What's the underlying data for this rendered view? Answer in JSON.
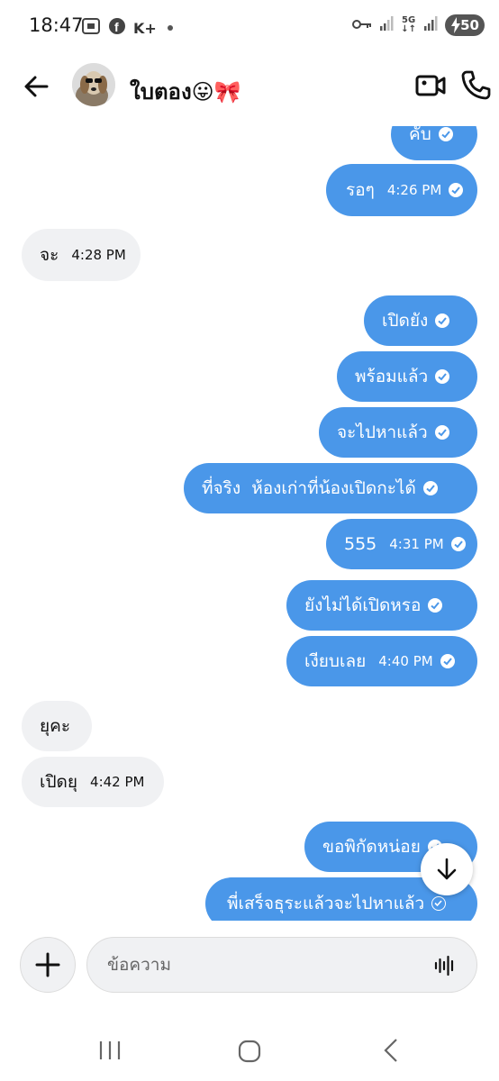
{
  "status_bar": {
    "time": "18:47",
    "carrier_badge": "K+",
    "network": "5G",
    "battery": "50"
  },
  "header": {
    "contact_name": "ใบตอง😛🎀"
  },
  "messages": [
    {
      "dir": "out",
      "text": "คับ",
      "time": "",
      "status": "read"
    },
    {
      "dir": "out",
      "text": "รอๆ",
      "time": "4:26 PM",
      "status": "read"
    },
    {
      "dir": "in",
      "text": "จะ",
      "time": "4:28 PM"
    },
    {
      "dir": "out",
      "text": "เปิดยัง",
      "time": "",
      "status": "read"
    },
    {
      "dir": "out",
      "text": "พร้อมแล้ว",
      "time": "",
      "status": "read"
    },
    {
      "dir": "out",
      "text": "จะไปหาแล้ว",
      "time": "",
      "status": "read"
    },
    {
      "dir": "out",
      "text": "ที่จริง  ห้องเก่าที่น้องเปิดกะได้",
      "time": "",
      "status": "read"
    },
    {
      "dir": "out",
      "text": "555",
      "time": "4:31 PM",
      "status": "read"
    },
    {
      "dir": "out",
      "text": "ยังไม่ได้เปิดหรอ",
      "time": "",
      "status": "read"
    },
    {
      "dir": "out",
      "text": "เงียบเลย",
      "time": "4:40 PM",
      "status": "read"
    },
    {
      "dir": "in",
      "text": "ยุคะ",
      "time": ""
    },
    {
      "dir": "in",
      "text": "เปิดยุ",
      "time": "4:42 PM"
    },
    {
      "dir": "out",
      "text": "ขอพิกัดหน่อย",
      "time": "",
      "status": "read"
    },
    {
      "dir": "out",
      "text": "พี่เสร็จธุระแล้วจะไปหาแล้ว",
      "time": "",
      "status": "sent"
    }
  ],
  "composer": {
    "placeholder": "ข้อความ"
  },
  "colors": {
    "outgoing_bubble": "#4a97e9",
    "incoming_bubble": "#f0f1f3"
  },
  "icons": {
    "back": "arrow-left-icon",
    "video": "video-camera-icon",
    "call": "phone-icon",
    "add": "plus-icon",
    "voice": "voice-wave-icon",
    "scroll": "arrow-down-icon"
  }
}
